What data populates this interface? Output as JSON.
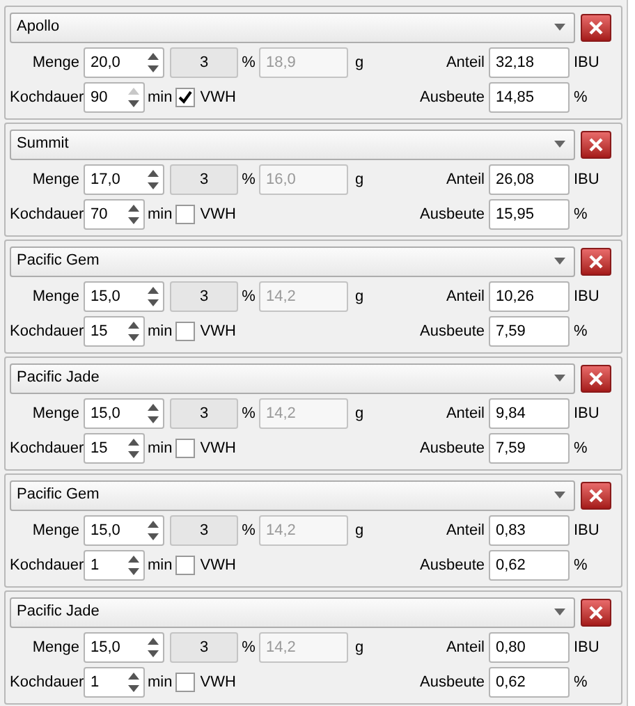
{
  "hops": [
    {
      "variety": "Apollo",
      "menge_label": "Menge",
      "menge": "20,0",
      "alpha": "3",
      "alpha_unit": "%",
      "amount": "18,9",
      "amount_unit": "g",
      "anteil_label": "Anteil",
      "anteil": "32,18",
      "anteil_unit": "IBU",
      "kochdauer_label": "Kochdauer",
      "kochdauer": "90",
      "kochdauer_up_disabled": true,
      "kochdauer_unit": "min",
      "vwh": {
        "label": "VWH",
        "checked": true
      },
      "ausbeute_label": "Ausbeute",
      "ausbeute": "14,85",
      "ausbeute_unit": "%"
    },
    {
      "variety": "Summit",
      "menge_label": "Menge",
      "menge": "17,0",
      "alpha": "3",
      "alpha_unit": "%",
      "amount": "16,0",
      "amount_unit": "g",
      "anteil_label": "Anteil",
      "anteil": "26,08",
      "anteil_unit": "IBU",
      "kochdauer_label": "Kochdauer",
      "kochdauer": "70",
      "kochdauer_up_disabled": false,
      "kochdauer_unit": "min",
      "vwh": {
        "label": "VWH",
        "checked": false
      },
      "ausbeute_label": "Ausbeute",
      "ausbeute": "15,95",
      "ausbeute_unit": "%"
    },
    {
      "variety": "Pacific Gem",
      "menge_label": "Menge",
      "menge": "15,0",
      "alpha": "3",
      "alpha_unit": "%",
      "amount": "14,2",
      "amount_unit": "g",
      "anteil_label": "Anteil",
      "anteil": "10,26",
      "anteil_unit": "IBU",
      "kochdauer_label": "Kochdauer",
      "kochdauer": "15",
      "kochdauer_up_disabled": false,
      "kochdauer_unit": "min",
      "vwh": {
        "label": "VWH",
        "checked": false
      },
      "ausbeute_label": "Ausbeute",
      "ausbeute": "7,59",
      "ausbeute_unit": "%"
    },
    {
      "variety": "Pacific Jade",
      "menge_label": "Menge",
      "menge": "15,0",
      "alpha": "3",
      "alpha_unit": "%",
      "amount": "14,2",
      "amount_unit": "g",
      "anteil_label": "Anteil",
      "anteil": "9,84",
      "anteil_unit": "IBU",
      "kochdauer_label": "Kochdauer",
      "kochdauer": "15",
      "kochdauer_up_disabled": false,
      "kochdauer_unit": "min",
      "vwh": {
        "label": "VWH",
        "checked": false
      },
      "ausbeute_label": "Ausbeute",
      "ausbeute": "7,59",
      "ausbeute_unit": "%"
    },
    {
      "variety": "Pacific Gem",
      "menge_label": "Menge",
      "menge": "15,0",
      "alpha": "3",
      "alpha_unit": "%",
      "amount": "14,2",
      "amount_unit": "g",
      "anteil_label": "Anteil",
      "anteil": "0,83",
      "anteil_unit": "IBU",
      "kochdauer_label": "Kochdauer",
      "kochdauer": "1",
      "kochdauer_up_disabled": false,
      "kochdauer_unit": "min",
      "vwh": {
        "label": "VWH",
        "checked": false
      },
      "ausbeute_label": "Ausbeute",
      "ausbeute": "0,62",
      "ausbeute_unit": "%"
    },
    {
      "variety": "Pacific Jade",
      "menge_label": "Menge",
      "menge": "15,0",
      "alpha": "3",
      "alpha_unit": "%",
      "amount": "14,2",
      "amount_unit": "g",
      "anteil_label": "Anteil",
      "anteil": "0,80",
      "anteil_unit": "IBU",
      "kochdauer_label": "Kochdauer",
      "kochdauer": "1",
      "kochdauer_up_disabled": false,
      "kochdauer_unit": "min",
      "vwh": {
        "label": "VWH",
        "checked": false
      },
      "ausbeute_label": "Ausbeute",
      "ausbeute": "0,62",
      "ausbeute_unit": "%"
    }
  ]
}
